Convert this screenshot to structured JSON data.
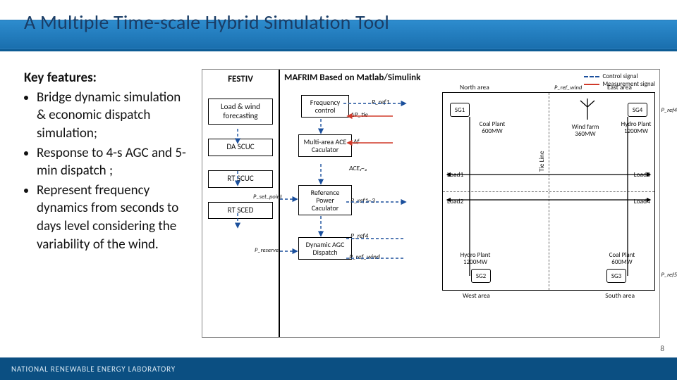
{
  "title": "A Multiple Time-scale Hybrid Simulation Tool",
  "features": {
    "heading": "Key features:",
    "items": [
      "Bridge dynamic simulation & economic dispatch simulation;",
      "Response to 4-s AGC and 5-min dispatch ;",
      "Represent frequency dynamics from seconds to days level considering the variability of the wind."
    ]
  },
  "festiv": {
    "header": "FESTIV",
    "boxes": [
      "Load & wind forecasting",
      "DA SCUC",
      "RT SCUC",
      "RT SCED"
    ]
  },
  "mafrim": {
    "header": "MAFRIM Based on Matlab/Simulink",
    "legend": {
      "control": "Control signal",
      "measure": "Measurement signal"
    },
    "left_boxes": {
      "freq": "Frequency control",
      "ace": "Multi-area ACE Caculator",
      "ref": "Reference Power Caculator",
      "agc": "Dynamic AGC Dispatch"
    },
    "signals": {
      "dptie": "ΔP_tie",
      "df": "Δf",
      "ace14": "ACE₁~₄",
      "pset": "P_set_point",
      "preserve": "P_reserve",
      "pref1": "P_ref1",
      "pref13": "P_ref1~3",
      "pref4": "P_ref4",
      "prefwind_in": "P_ref_wind",
      "prefwind": "P_ref_wind",
      "pref4r": "P_ref4",
      "pref5": "P_ref5"
    },
    "areas": {
      "na": "North area",
      "ea": "East area",
      "wa": "West area",
      "sa": "South area",
      "tie": "Tie Line",
      "loads": [
        "Load1",
        "Load2",
        "Load3",
        "Load4"
      ],
      "sg": [
        "SG1",
        "SG2",
        "SG3",
        "SG4"
      ],
      "plants": {
        "coal_n": "Coal Plant 600MW",
        "wind": "Wind farm 360MW",
        "hydro_e": "Hydro Plant 1200MW",
        "hydro_w": "Hydro Plant 1200MW",
        "coal_s": "Coal Plant 600MW"
      }
    }
  },
  "footer": "NATIONAL RENEWABLE ENERGY LABORATORY",
  "page": "8"
}
